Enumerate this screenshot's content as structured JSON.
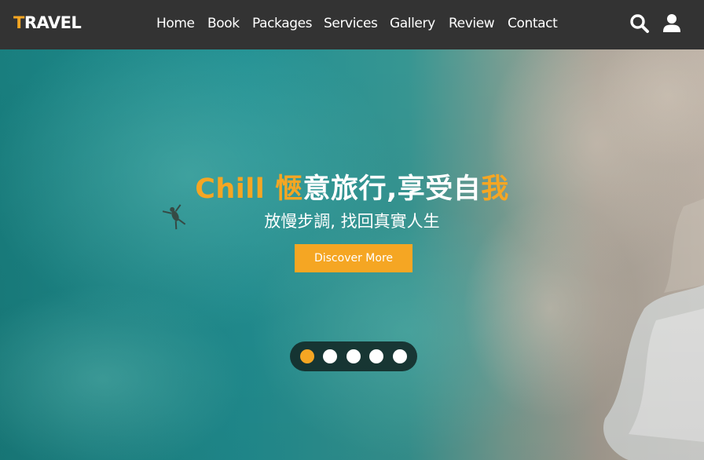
{
  "brand": {
    "first_letter": "T",
    "rest": "RAVEL"
  },
  "nav": {
    "items": [
      {
        "label": "Home"
      },
      {
        "label": "Book"
      },
      {
        "label": "Packages"
      },
      {
        "label": "Services"
      },
      {
        "label": "Gallery"
      },
      {
        "label": "Review"
      },
      {
        "label": "Contact"
      }
    ],
    "icons": [
      "search-icon",
      "user-icon"
    ]
  },
  "hero": {
    "title_part1": "Chill 愜",
    "title_part2": "意旅行,享受自",
    "title_part3": "我",
    "subtitle": "放慢步調, 找回真實人生",
    "cta_label": "Discover More",
    "slides_count": 5,
    "active_slide": 1
  },
  "colors": {
    "accent": "#f5a623",
    "header_bg": "#333333",
    "text": "#ffffff"
  }
}
